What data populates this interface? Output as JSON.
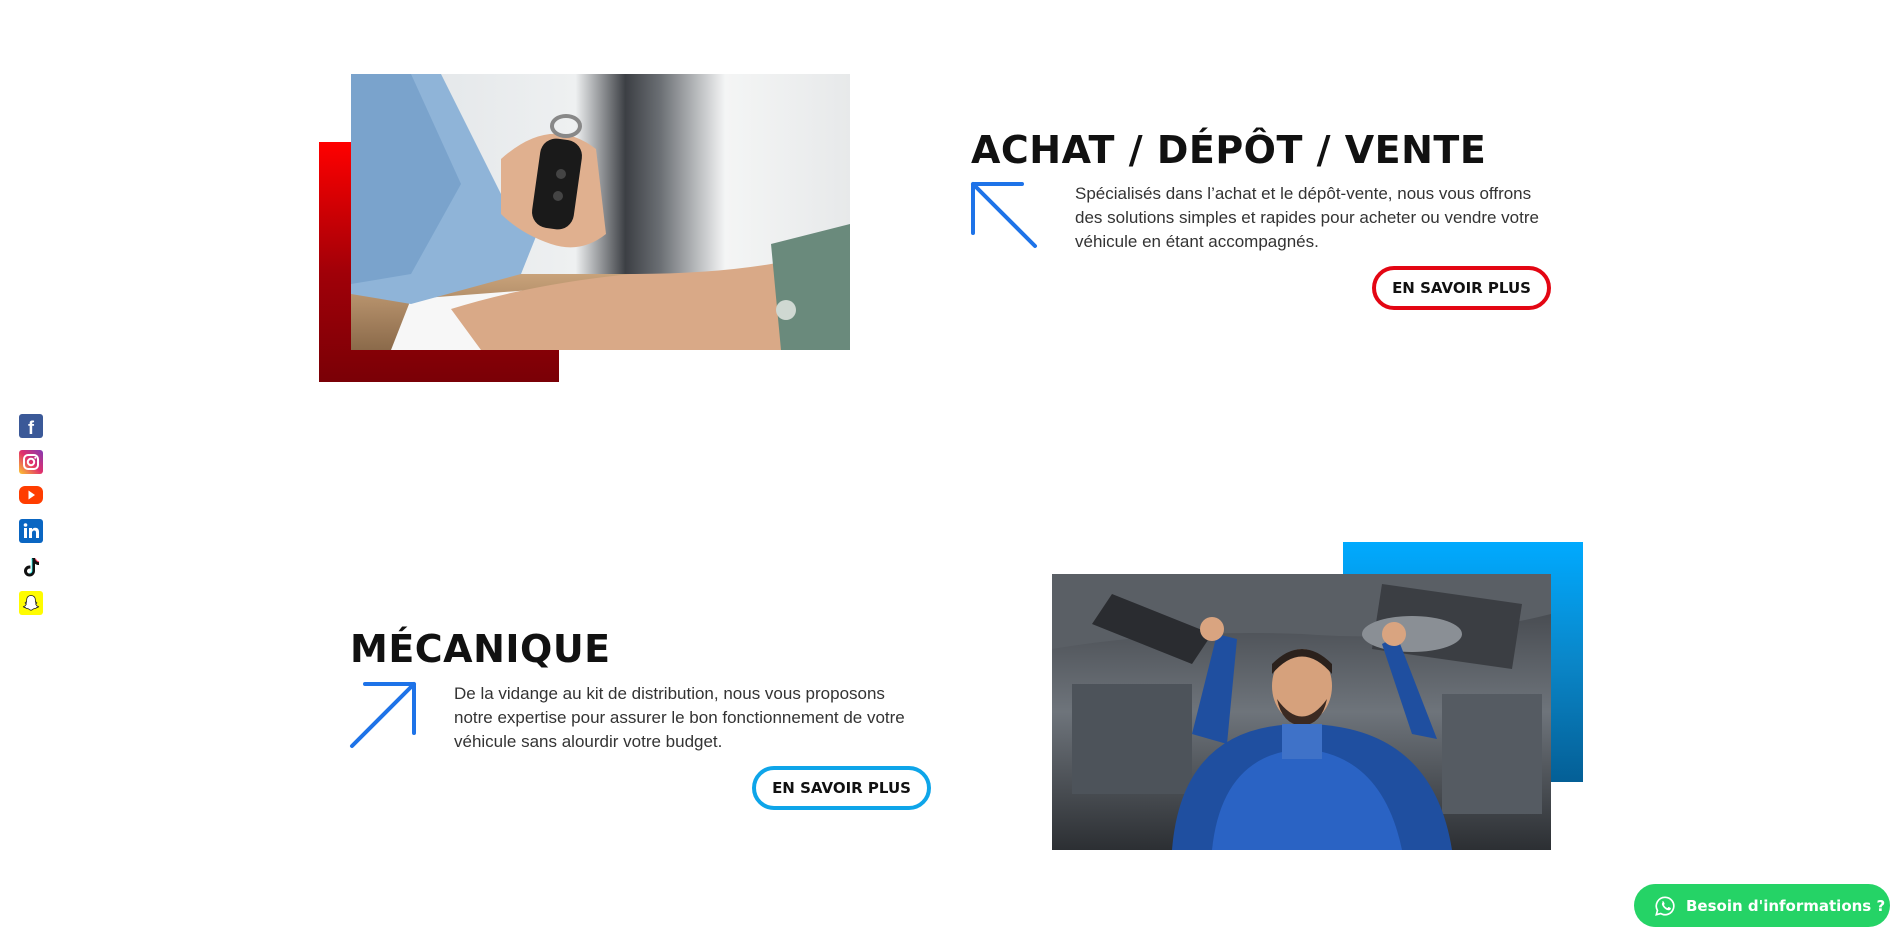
{
  "social": {
    "items": [
      {
        "name": "facebook",
        "icon": "facebook-icon",
        "color": "#3b5998"
      },
      {
        "name": "instagram",
        "icon": "instagram-icon",
        "color": "#e1306c"
      },
      {
        "name": "youtube",
        "icon": "youtube-icon",
        "color": "#ff3d00"
      },
      {
        "name": "linkedin",
        "icon": "linkedin-icon",
        "color": "#0a66c2"
      },
      {
        "name": "tiktok",
        "icon": "tiktok-icon",
        "color": "#000000"
      },
      {
        "name": "snapchat",
        "icon": "snapchat-icon",
        "color": "#fffc00"
      }
    ]
  },
  "sections": {
    "achat": {
      "title": "ACHAT / DÉPÔT / VENTE",
      "description": "Spécialisés dans l’achat et le dépôt-vente, nous vous offrons des solutions simples et rapides pour acheter ou vendre votre véhicule en étant accompagnés.",
      "button_label": "EN SAVOIR PLUS",
      "accent_color": "#e30613",
      "arrow_icon": "arrow-up-left-icon",
      "image_icon": "car-keys-photo"
    },
    "mecanique": {
      "title": "MÉCANIQUE",
      "description": "De la vidange au kit de distribution, nous vous proposons notre expertise pour assurer le bon fonctionnement de votre véhicule sans alourdir votre budget.",
      "button_label": "EN SAVOIR PLUS",
      "accent_color": "#0ea5e9",
      "arrow_icon": "arrow-up-right-icon",
      "image_icon": "mechanic-photo"
    }
  },
  "whatsapp": {
    "label": "Besoin d'informations ?",
    "icon": "whatsapp-icon",
    "color": "#25d366"
  }
}
